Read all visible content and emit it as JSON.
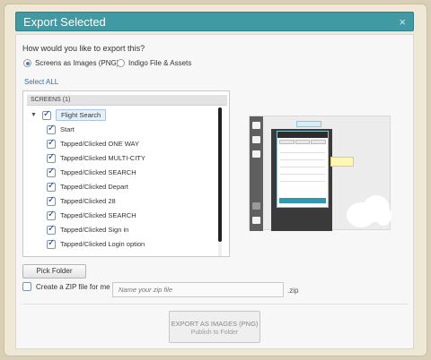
{
  "dialog": {
    "title": "Export Selected",
    "close": "×"
  },
  "export": {
    "question": "How would you like to export this?",
    "options": [
      {
        "label": "Screens as Images (PNG)",
        "selected": true
      },
      {
        "label": "Indigo File & Assets",
        "selected": false
      }
    ],
    "select_all": "Select ALL"
  },
  "screens": {
    "header": "SCREENS (1)",
    "root": {
      "label": "Flight Search",
      "checked": true
    },
    "items": [
      {
        "label": "Start",
        "checked": true
      },
      {
        "label": "Tapped/Clicked ONE WAY",
        "checked": true
      },
      {
        "label": "Tapped/Clicked MULTI-CITY",
        "checked": true
      },
      {
        "label": "Tapped/Clicked SEARCH",
        "checked": true
      },
      {
        "label": "Tapped/Clicked Depart",
        "checked": true
      },
      {
        "label": "Tapped/Clicked 28",
        "checked": true
      },
      {
        "label": "Tapped/Clicked SEARCH",
        "checked": true
      },
      {
        "label": "Tapped/Clicked Sign in",
        "checked": true
      },
      {
        "label": "Tapped/Clicked Login option",
        "checked": true
      }
    ]
  },
  "buttons": {
    "pick_folder": "Pick Folder",
    "export_main": "EXPORT AS IMAGES (PNG)",
    "export_sub": "Publish to Folder"
  },
  "zip": {
    "label": "Create a ZIP file for me",
    "checked": false,
    "placeholder": "Name your zip file",
    "ext": ".zip"
  },
  "colors": {
    "titlebar": "#3f9aa4",
    "accent": "#2b6fc2"
  }
}
